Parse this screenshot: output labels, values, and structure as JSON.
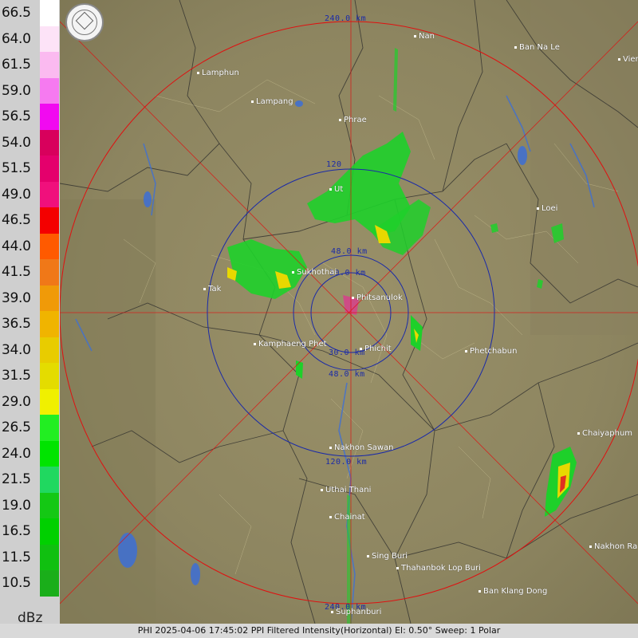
{
  "legend": {
    "unit": "dBz",
    "levels": [
      {
        "label": "66.5",
        "color": "#ffffff"
      },
      {
        "label": "64.0",
        "color": "#fde3f7"
      },
      {
        "label": "61.5",
        "color": "#fbbaf0"
      },
      {
        "label": "59.0",
        "color": "#f67af0"
      },
      {
        "label": "56.5",
        "color": "#f10af0"
      },
      {
        "label": "54.0",
        "color": "#d8005c"
      },
      {
        "label": "51.5",
        "color": "#e4006c"
      },
      {
        "label": "49.0",
        "color": "#f0107c"
      },
      {
        "label": "46.5",
        "color": "#f40000"
      },
      {
        "label": "44.0",
        "color": "#ff5a00"
      },
      {
        "label": "41.5",
        "color": "#f07818"
      },
      {
        "label": "39.0",
        "color": "#f09a08"
      },
      {
        "label": "36.5",
        "color": "#f0b400"
      },
      {
        "label": "34.0",
        "color": "#e8cc00"
      },
      {
        "label": "31.5",
        "color": "#e4dc00"
      },
      {
        "label": "29.0",
        "color": "#f0f000"
      },
      {
        "label": "26.5",
        "color": "#22ee22"
      },
      {
        "label": "24.0",
        "color": "#00e400"
      },
      {
        "label": "21.5",
        "color": "#20d860"
      },
      {
        "label": "19.0",
        "color": "#14c814"
      },
      {
        "label": "16.5",
        "color": "#00d000"
      },
      {
        "label": "11.5",
        "color": "#10c010"
      },
      {
        "label": "10.5",
        "color": "#1aae1a"
      }
    ]
  },
  "ring_labels": {
    "r240_top": "240.0 km",
    "r120_top": "120",
    "r48_top": "48.0 km",
    "r30_top": "30.0 km",
    "r30_bottom": "30.0 km",
    "r48_bottom": "48.0 km",
    "r120_bottom": "120.0 km",
    "r240_bottom": "240.0 km"
  },
  "cities": [
    {
      "id": "nan",
      "label": "Nan"
    },
    {
      "id": "ban-na-le",
      "label": "Ban Na Le"
    },
    {
      "id": "vien",
      "label": "Vien"
    },
    {
      "id": "lamphun",
      "label": "Lamphun"
    },
    {
      "id": "lampang",
      "label": "Lampang"
    },
    {
      "id": "phrae",
      "label": "Phrae"
    },
    {
      "id": "ut",
      "label": "Ut"
    },
    {
      "id": "loei",
      "label": "Loei"
    },
    {
      "id": "sukhothai",
      "label": "Sukhothai"
    },
    {
      "id": "phitsanulok",
      "label": "Phitsanulok"
    },
    {
      "id": "tak",
      "label": "Tak"
    },
    {
      "id": "kamphaeng-phet",
      "label": "Kamphaeng Phet"
    },
    {
      "id": "phichit",
      "label": "Phichit"
    },
    {
      "id": "phetchabun",
      "label": "Phetchabun"
    },
    {
      "id": "chaiyaphum",
      "label": "Chaiyaphum"
    },
    {
      "id": "nakhon-sawan",
      "label": "Nakhon Sawan"
    },
    {
      "id": "uthai-thani",
      "label": "Uthai Thani"
    },
    {
      "id": "chainat",
      "label": "Chainat"
    },
    {
      "id": "nakhon-ratchasima",
      "label": "Nakhon Ra"
    },
    {
      "id": "sing-buri",
      "label": "Sing Buri"
    },
    {
      "id": "thahanbok-lop-buri",
      "label": "Thahanbok Lop Buri"
    },
    {
      "id": "ban-klang-dong",
      "label": "Ban Klang Dong"
    },
    {
      "id": "suphanburi",
      "label": "Suphanburi"
    }
  ],
  "status": {
    "text": "PHI 2025-04-06 17:45:02 PPI Filtered Intensity(Horizontal)  El: 0.50°  Sweep: 1 Polar"
  }
}
